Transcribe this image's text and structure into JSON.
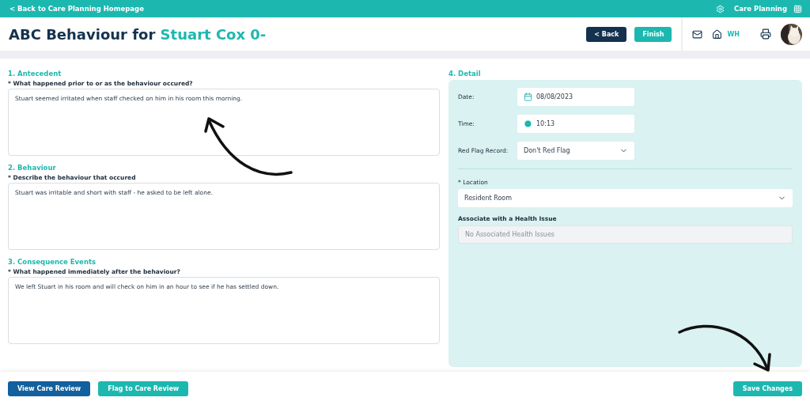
{
  "top_bar": {
    "back_link": "< Back to Care Planning Homepage",
    "app_name": "Care Planning"
  },
  "header": {
    "title": "ABC Behaviour for",
    "subject": "Stuart Cox 0-",
    "buttons": [
      {
        "label": "< Back",
        "kind": "dark"
      },
      {
        "label": "Finish",
        "kind": "teal"
      }
    ],
    "home_label": "WH"
  },
  "sections": [
    {
      "heading": "1. Antecedent",
      "question": "* What happened prior to or as the behaviour occured?",
      "answer": "Stuart seemed irritated when staff checked on him in his room this morning."
    },
    {
      "heading": "2. Behaviour",
      "question": "* Describe the behaviour that occured",
      "answer": "Stuart was irritable and short with staff - he asked to be left alone."
    },
    {
      "heading": "3. Consequence Events",
      "question": "* What happened immediately after the behaviour?",
      "answer": "We left Stuart in his room and will check on him in an hour to see if he has settled down."
    }
  ],
  "detail": {
    "heading": "4. Detail",
    "fields": [
      {
        "label": "Date:",
        "value": "08/08/2023",
        "kind": "date"
      },
      {
        "label": "Time:",
        "value": "10:13",
        "kind": "time"
      },
      {
        "label": "Red Flag Record:",
        "value": "Don't Red Flag",
        "kind": "select"
      }
    ],
    "location": {
      "label": "* Location",
      "value": "Resident Room"
    },
    "health_issue": {
      "label": "Associate with a Health Issue",
      "placeholder": "No Associated Health Issues",
      "disabled": true
    }
  },
  "footer": {
    "buttons": [
      {
        "label": "View Care Review",
        "kind": "dark"
      },
      {
        "label": "Flag to Care Review",
        "kind": "teal"
      }
    ],
    "save": "Save Changes"
  }
}
